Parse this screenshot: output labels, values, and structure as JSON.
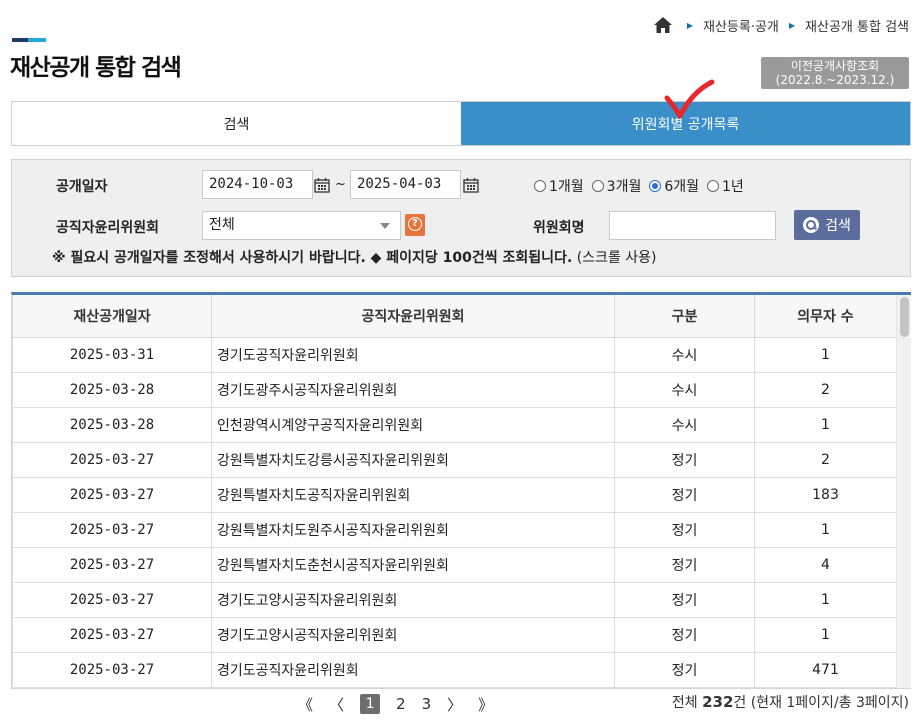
{
  "breadcrumb": {
    "items": [
      "재산등록·공개",
      "재산공개 통합 검색"
    ]
  },
  "page": {
    "title": "재산공개 통합 검색",
    "prev_button_line1": "이전공개사항조회",
    "prev_button_line2": "(2022.8.~2023.12.)"
  },
  "tabs": [
    {
      "label": "검색",
      "active": false
    },
    {
      "label": "위원회별 공개목록",
      "active": true
    }
  ],
  "filter": {
    "date_label": "공개일자",
    "date_from": "2024-10-03",
    "date_to": "2025-04-03",
    "tilde": "~",
    "periods": [
      {
        "label": "1개월",
        "checked": false
      },
      {
        "label": "3개월",
        "checked": false
      },
      {
        "label": "6개월",
        "checked": true
      },
      {
        "label": "1년",
        "checked": false
      }
    ],
    "committee_label": "공직자윤리위원회",
    "committee_value": "전체",
    "committee_name_label": "위원회명",
    "committee_name_value": "",
    "search_button": "검색",
    "notice_bold": "※ 필요시 공개일자를 조정해서 사용하시기 바랍니다. ◆ 페이지당 100건씩 조회됩니다.",
    "notice_normal": "(스크롤 사용)"
  },
  "table": {
    "headers": [
      "재산공개일자",
      "공직자윤리위원회",
      "구분",
      "의무자 수"
    ],
    "rows": [
      [
        "2025-03-31",
        "경기도공직자윤리위원회",
        "수시",
        "1"
      ],
      [
        "2025-03-28",
        "경기도광주시공직자윤리위원회",
        "수시",
        "2"
      ],
      [
        "2025-03-28",
        "인천광역시계양구공직자윤리위원회",
        "수시",
        "1"
      ],
      [
        "2025-03-27",
        "강원특별자치도강릉시공직자윤리위원회",
        "정기",
        "2"
      ],
      [
        "2025-03-27",
        "강원특별자치도공직자윤리위원회",
        "정기",
        "183"
      ],
      [
        "2025-03-27",
        "강원특별자치도원주시공직자윤리위원회",
        "정기",
        "1"
      ],
      [
        "2025-03-27",
        "강원특별자치도춘천시공직자윤리위원회",
        "정기",
        "4"
      ],
      [
        "2025-03-27",
        "경기도고양시공직자윤리위원회",
        "정기",
        "1"
      ],
      [
        "2025-03-27",
        "경기도고양시공직자윤리위원회",
        "정기",
        "1"
      ],
      [
        "2025-03-27",
        "경기도공직자윤리위원회",
        "정기",
        "471"
      ]
    ]
  },
  "pagination": {
    "first": "《",
    "prev": "〈",
    "pages": [
      "1",
      "2",
      "3"
    ],
    "current": "1",
    "next": "〉",
    "last": "》",
    "total_prefix": "전체",
    "total_count": "232",
    "total_suffix": "건 (현재 1페이지/총 3페이지)"
  },
  "colors": {
    "tab_active": "#3a8fc9",
    "table_top_border": "#4a7cb0",
    "search_button": "#5a6d9c",
    "help_button": "#e8743b",
    "annotation_check": "#e8262b"
  }
}
